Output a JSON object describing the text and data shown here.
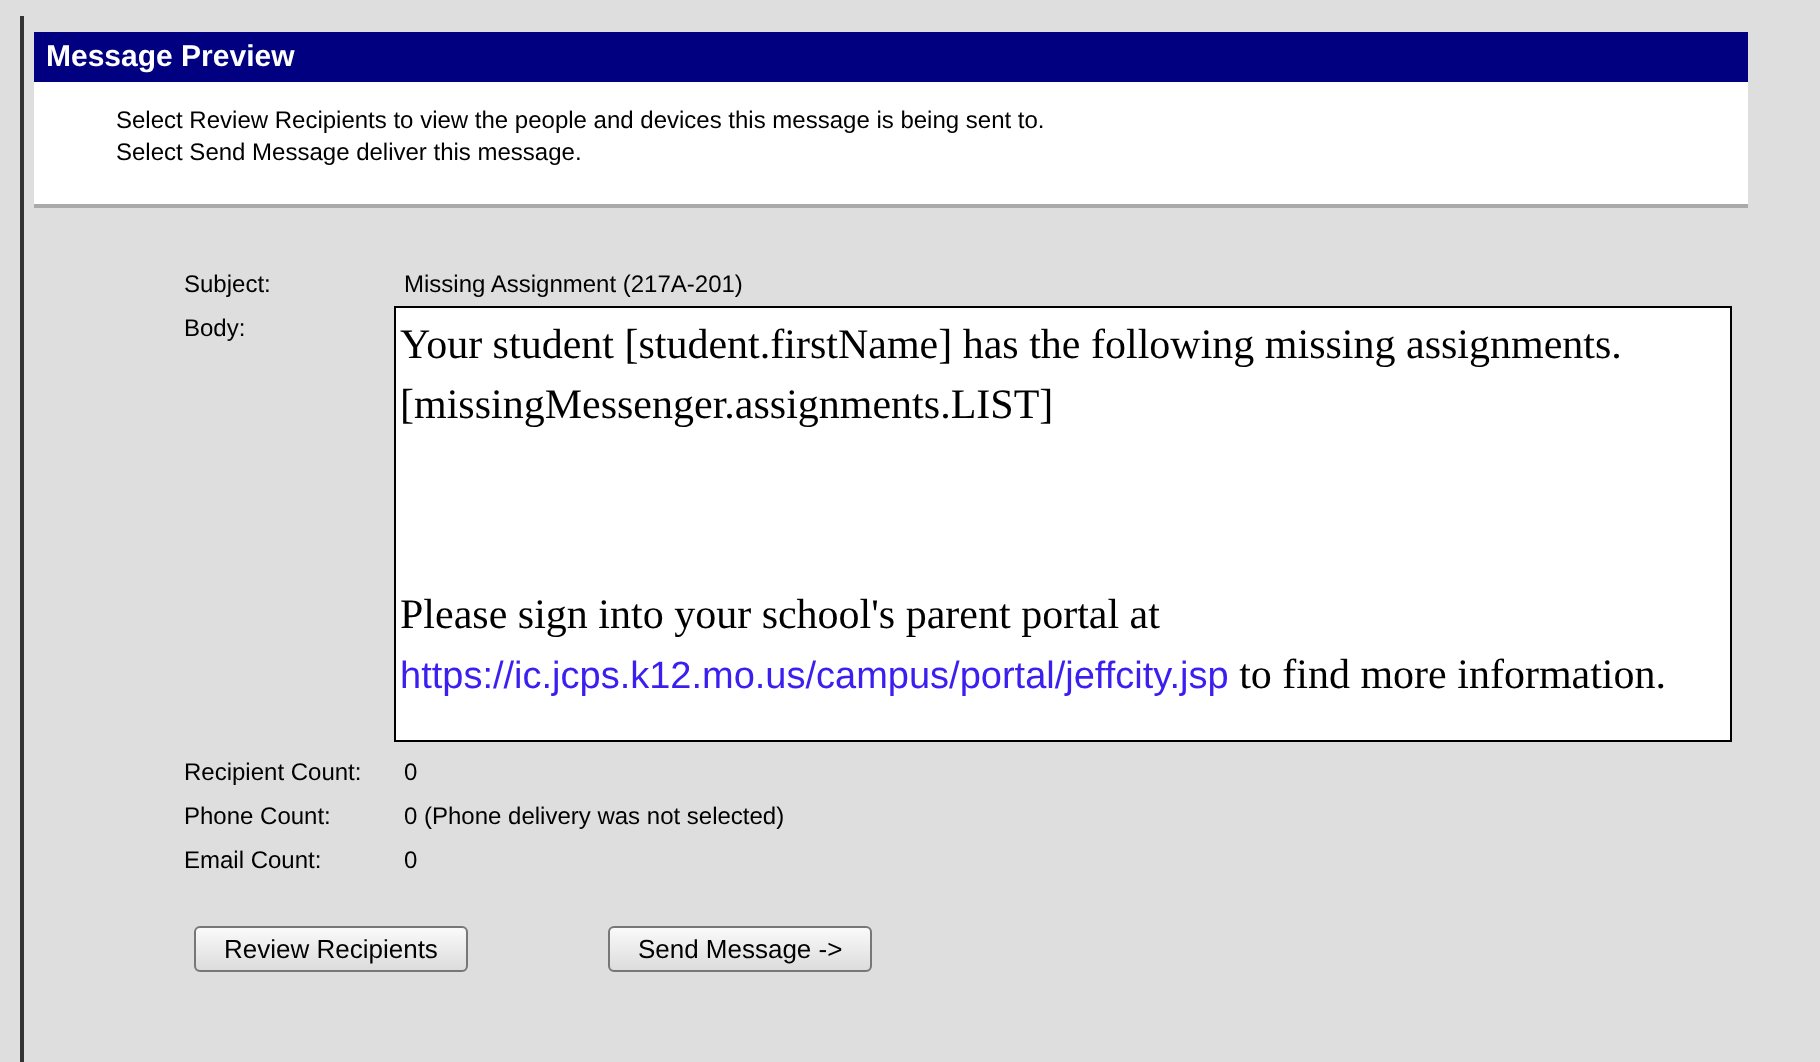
{
  "title": "Message Preview",
  "instructions": [
    "Select Review Recipients to view the people and devices this message is being sent to.",
    "Select Send Message deliver this message."
  ],
  "subject": {
    "label": "Subject:",
    "value": "Missing Assignment (217A-201)"
  },
  "body": {
    "label": "Body:",
    "paragraphs": [
      {
        "kind": "text",
        "text": "Your student [student.firstName] has the following missing assignments."
      },
      {
        "kind": "text",
        "text": "[missingMessenger.assignments.LIST]"
      },
      {
        "kind": "spacer"
      },
      {
        "kind": "link_text",
        "before": "Please sign into your school's parent portal at ",
        "link": "https://ic.jcps.k12.mo.us/campus/portal/jeffcity.jsp",
        "after": " to find more information."
      }
    ]
  },
  "counts": [
    {
      "label": "Recipient Count:",
      "value": "0"
    },
    {
      "label": "Phone Count:",
      "value": "0 (Phone delivery was not selected)"
    },
    {
      "label": "Email Count:",
      "value": "0"
    }
  ],
  "buttons": [
    "Review Recipients",
    "Send Message ->"
  ]
}
